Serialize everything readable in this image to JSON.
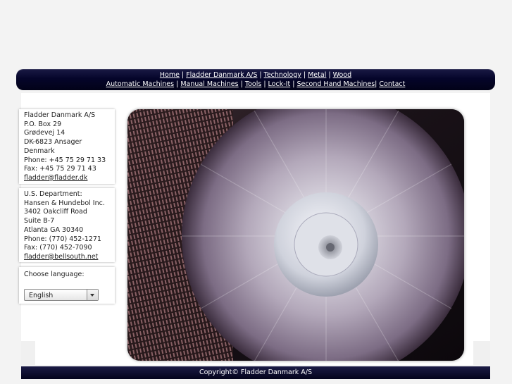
{
  "nav": {
    "row1": [
      "Home",
      "Fladder Danmark A/S",
      "Technology",
      "Metal",
      "Wood"
    ],
    "row2": [
      "Automatic Machines",
      "Manual Machines",
      "Tools",
      "Lock-It",
      "Second Hand Machines",
      "Contact"
    ]
  },
  "contact_dk": {
    "lines": [
      "Fladder Danmark A/S",
      "P.O. Box 29",
      "Grødevej 14",
      "DK-6823 Ansager",
      "Denmark",
      "Phone: +45 75 29 71 33",
      "Fax: +45 75 29 71 43"
    ],
    "email": "fladder@fladder.dk"
  },
  "contact_us": {
    "lines": [
      "U.S. Department:",
      "Hansen & Hundebol Inc.",
      "3402 Oakcliff Road",
      "Suite B-7",
      "Atlanta GA 30340",
      "Phone: (770) 452-1271",
      "Fax: (770) 452-7090"
    ],
    "email": "fladder@bellsouth.net"
  },
  "language": {
    "label": "Choose language:",
    "selected": "English"
  },
  "footer": {
    "copyright": "Copyright© Fladder Danmark A/S"
  },
  "colors": {
    "nav_bg": "#05052a",
    "footer_bg": "#0a0a30",
    "page_bg": "#f3f3f3"
  }
}
